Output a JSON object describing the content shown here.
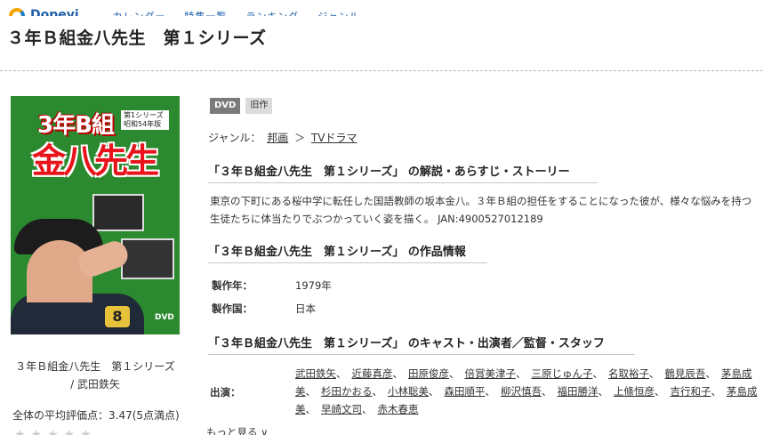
{
  "nav": {
    "brand": "Dopeyi",
    "text": "… カレンダー … 特集一覧 … ランキング … ジャンル"
  },
  "page": {
    "title": "３年Ｂ組金八先生　第１シリーズ"
  },
  "poster": {
    "title_top": "3年B組",
    "title_main": "金八先生",
    "series_box": "第1シリーズ 昭和54年版",
    "volume_number": "8",
    "format_mark": "DVD",
    "caption_line1": "３年Ｂ組金八先生　第１シリーズ",
    "caption_line2": "/ 武田鉄矢"
  },
  "rating": {
    "text": "全体の平均評価点：3.47(5点満点)",
    "stars": "★★★★★",
    "value": 3.47,
    "max": 5
  },
  "badges": [
    "DVD",
    "旧作"
  ],
  "genre": {
    "label": "ジャンル：",
    "first": "邦画",
    "separator": "＞",
    "second": "TVドラマ"
  },
  "sections": {
    "synopsis_heading": "「３年Ｂ組金八先生　第１シリーズ」 の解説・あらすじ・ストーリー",
    "synopsis_text": "東京の下町にある桜中学に転任した国語教師の坂本金八。３年Ｂ組の担任をすることになった彼が、様々な悩みを持つ生徒たちに体当たりでぶつかっていく姿を描く。 JAN:4900527012189",
    "info_heading": "「３年Ｂ組金八先生　第１シリーズ」 の作品情報",
    "cast_heading": "「３年Ｂ組金八先生　第１シリーズ」 のキャスト・出演者／監督・スタッフ"
  },
  "info": {
    "year_label": "製作年：",
    "year_value": "1979年",
    "country_label": "製作国：",
    "country_value": "日本"
  },
  "cast": {
    "label": "出演：",
    "names": [
      "武田鉄矢",
      "近藤真彦",
      "田原俊彦",
      "倍賞美津子",
      "三原じゅん子",
      "名取裕子",
      "鶴見辰吾",
      "茅島成美",
      "杉田かおる",
      "小林聡美",
      "森田順平",
      "柳沢慎吾",
      "福田勝洋",
      "上條恒彦",
      "吉行和子",
      "茅島成美",
      "早崎文司",
      "赤木春恵"
    ],
    "separator": "、",
    "more_label": "もっと見る ∨"
  }
}
